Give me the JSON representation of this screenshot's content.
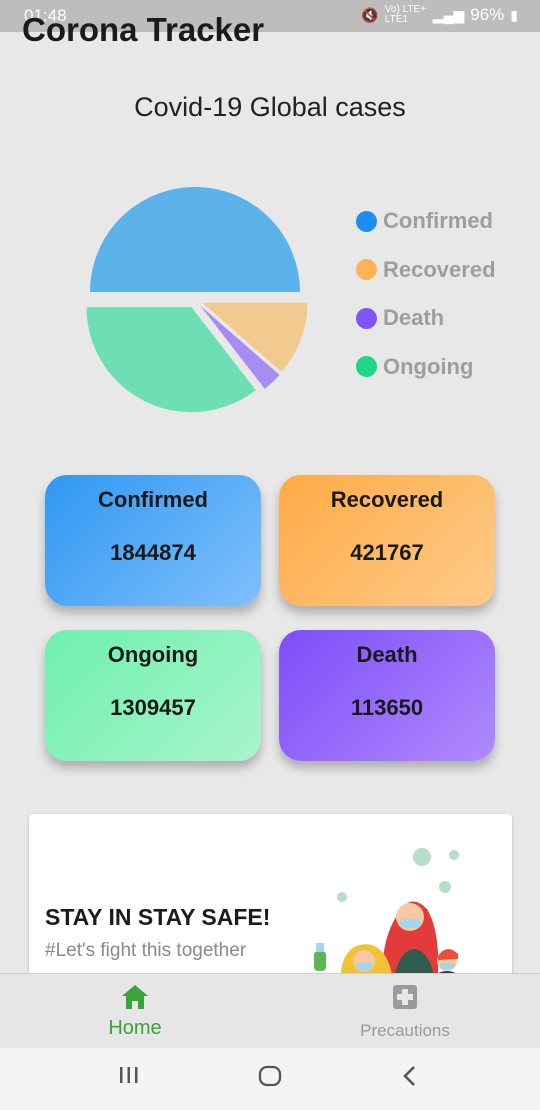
{
  "status_bar": {
    "time": "01:48",
    "network": "Vo) LTE+ LTE1",
    "battery": "96%"
  },
  "app_title": "Corona Tracker",
  "heading": "Covid-19 Global cases",
  "chart_data": {
    "type": "pie",
    "title": "",
    "labels": [
      "Confirmed",
      "Recovered",
      "Death",
      "Ongoing"
    ],
    "values": [
      1844874,
      421767,
      113650,
      1309457
    ],
    "colors": [
      "#5cb3ec",
      "#f2c98e",
      "#a78cf2",
      "#6edfb5"
    ],
    "legend_position": "right"
  },
  "legend": [
    {
      "label": "Confirmed",
      "color": "#1a8ff0"
    },
    {
      "label": "Recovered",
      "color": "#ffb357"
    },
    {
      "label": "Death",
      "color": "#7d55f2"
    },
    {
      "label": "Ongoing",
      "color": "#1ed589"
    }
  ],
  "cards": {
    "confirmed": {
      "title": "Confirmed",
      "value": "1844874"
    },
    "recovered": {
      "title": "Recovered",
      "value": "421767"
    },
    "ongoing": {
      "title": "Ongoing",
      "value": "1309457"
    },
    "death": {
      "title": "Death",
      "value": "113650"
    }
  },
  "banner": {
    "title": "STAY IN STAY SAFE!",
    "subtitle": "#Let's fight this together"
  },
  "bottom_nav": {
    "home": {
      "label": "Home",
      "icon": "home-icon",
      "active": true,
      "color": "#3aa33a"
    },
    "precautions": {
      "label": "Precautions",
      "icon": "medical-cross-icon",
      "active": false
    }
  },
  "system_nav": {
    "icons": [
      "recent-apps-icon",
      "home-circle-icon",
      "back-icon"
    ]
  }
}
